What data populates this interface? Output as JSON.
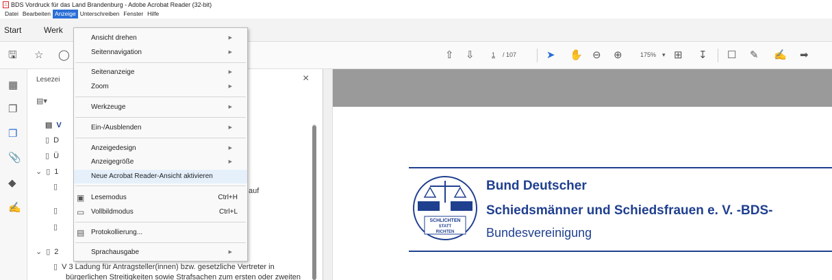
{
  "window": {
    "title": "BDS Vordruck für das Land Brandenburg - Adobe Acrobat Reader (32-bit)"
  },
  "menubar": [
    "Datei",
    "Bearbeiten",
    "Anzeige",
    "Unterschreiben",
    "Fenster",
    "Hilfe"
  ],
  "tabs": {
    "start": "Start",
    "werkzeuge_partial": "Werk"
  },
  "toolbar": {
    "page_current": "1",
    "page_total": "/ 107",
    "zoom": "175%"
  },
  "panel": {
    "title_partial": "Lesezei",
    "close": "×"
  },
  "bookmarks": {
    "b1": "V",
    "b2": "D",
    "b3": "Ü",
    "b4": "1",
    "b4_tail": "auf",
    "b8": "2",
    "b9": "V 3  Ladung für Antragsteller(innen) bzw. gesetzliche Vertreter in",
    "b10": "bürgerlichen Streitigkeiten sowie Strafsachen zum ersten oder zweiten"
  },
  "menu": {
    "ansicht_drehen": "Ansicht drehen",
    "seitennavigation": "Seitennavigation",
    "seitenanzeige": "Seitenanzeige",
    "zoom": "Zoom",
    "werkzeuge": "Werkzeuge",
    "ein_ausblenden": "Ein-/Ausblenden",
    "anzeigedesign": "Anzeigedesign",
    "anzeigegroesse": "Anzeigegröße",
    "neue_ansicht": "Neue Acrobat Reader-Ansicht aktivieren",
    "lesemodus": "Lesemodus",
    "lesemodus_sc": "Ctrl+H",
    "vollbildmodus": "Vollbildmodus",
    "vollbildmodus_sc": "Ctrl+L",
    "protokollierung": "Protokollierung...",
    "sprachausgabe": "Sprachausgabe"
  },
  "document": {
    "line1": "Bund Deutscher",
    "line2": "Schiedsmänner und Schiedsfrauen e. V. -BDS-",
    "line3": "Bundesvereinigung",
    "logo_text": [
      "SCHLICHTEN",
      "STATT",
      "RICHTEN"
    ]
  },
  "colors": {
    "accent": "#2a6fd6",
    "brand_blue": "#1f3f8f",
    "pdf_red": "#d4201f"
  }
}
